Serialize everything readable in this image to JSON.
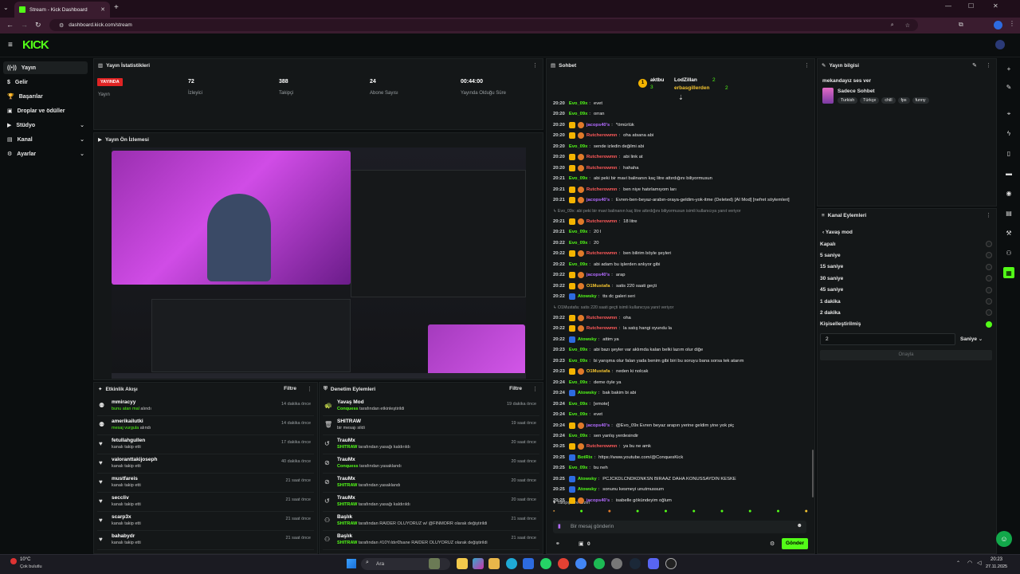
{
  "browser": {
    "tab_title": "Stream - Kick Dashboard",
    "url": "dashboard.kick.com/stream"
  },
  "header": {
    "logo": "KICK"
  },
  "sidebar": {
    "items": [
      {
        "label": "Yayın",
        "icon": "live-icon"
      },
      {
        "label": "Gelir",
        "icon": "money-icon"
      },
      {
        "label": "Başarılar",
        "icon": "trophy-icon"
      },
      {
        "label": "Droplar ve ödüller",
        "icon": "gift-icon"
      },
      {
        "label": "Stüdyo",
        "icon": "camera-icon"
      },
      {
        "label": "Kanal",
        "icon": "channel-icon"
      },
      {
        "label": "Ayarlar",
        "icon": "settings-icon"
      }
    ]
  },
  "stats": {
    "title": "Yayın İstatistikleri",
    "status": "YAYINDA",
    "status_label": "Yayın",
    "items": [
      {
        "value": "72",
        "label": "İzleyici"
      },
      {
        "value": "388",
        "label": "Takipçi"
      },
      {
        "value": "24",
        "label": "Abone Sayısı"
      },
      {
        "value": "00:44:00",
        "label": "Yayında Olduğu Süre"
      }
    ]
  },
  "preview": {
    "title": "Yayın Ön İzlemesi"
  },
  "activity": {
    "title": "Etkinlik Akışı",
    "filter": "Filtre",
    "rows": [
      {
        "name": "mmiracyy",
        "sub": "bunu atan mal",
        "sub2": "alındı",
        "time": "14 dakika önce"
      },
      {
        "name": "amerikailutki",
        "sub": "mesaj vurgula",
        "sub2": "alındı",
        "time": "14 dakika önce"
      },
      {
        "name": "fetullahgullen",
        "sub": "kanalı takip etti",
        "sub2": "",
        "time": "17 dakika önce"
      },
      {
        "name": "valoranttakijoseph",
        "sub": "kanalı takip etti",
        "sub2": "",
        "time": "40 dakika önce"
      },
      {
        "name": "mustfareis",
        "sub": "kanalı takip etti",
        "sub2": "",
        "time": "21 saat önce"
      },
      {
        "name": "seccliv",
        "sub": "kanalı takip etti",
        "sub2": "",
        "time": "21 saat önce"
      },
      {
        "name": "scarp3x",
        "sub": "kanalı takip etti",
        "sub2": "",
        "time": "21 saat önce"
      },
      {
        "name": "bahabydr",
        "sub": "kanalı takip etti",
        "sub2": "",
        "time": "21 saat önce"
      }
    ]
  },
  "moderation": {
    "title": "Denetim Eylemleri",
    "filter": "Filtre",
    "rows": [
      {
        "name": "Yavaş Mod",
        "actor": "Conquess",
        "sub": "tarafından etkinleştirildi",
        "time": "19 dakika önce"
      },
      {
        "name": "SHITRAW",
        "actor": "",
        "sub": "bir mesajı sildi",
        "time": "19 saat önce"
      },
      {
        "name": "TrauMx",
        "actor": "SHITRAW",
        "sub": "tarafından yasağı kaldırıldı",
        "time": "20 saat önce"
      },
      {
        "name": "TrauMx",
        "actor": "Conquess",
        "sub": "tarafından yasaklandı",
        "time": "20 saat önce"
      },
      {
        "name": "TrauMx",
        "actor": "SHITRAW",
        "sub": "tarafından yasaklandı",
        "time": "20 saat önce"
      },
      {
        "name": "TrauMx",
        "actor": "SHITRAW",
        "sub": "tarafından yasağı kaldırıldı",
        "time": "20 saat önce"
      },
      {
        "name": "Başlık",
        "actor": "SHITRAW",
        "sub": "tarafından RAIDER OLUYORUZ w/ @FINMORR olarak değiştirildi",
        "time": "21 saat önce"
      },
      {
        "name": "Başlık",
        "actor": "SHITRAW",
        "sub": "tarafından #10Yıldır€fsane RAIDER OLUYORUZ olarak değiştirildi",
        "time": "21 saat önce"
      }
    ]
  },
  "chat": {
    "title": "Sohbet",
    "leaders": [
      {
        "rank": "1",
        "name": "aktbu",
        "count": ""
      },
      {
        "rank": "",
        "name": "LodZillan",
        "count": "2"
      },
      {
        "rank": "",
        "name": "3",
        "count": ""
      },
      {
        "rank": "",
        "name": "erbasgillerden",
        "count": "2"
      }
    ],
    "messages": [
      {
        "t": "20:20",
        "user": "Evo_09x",
        "color": "#53fc18",
        "msg": "evet"
      },
      {
        "t": "20:20",
        "user": "Evo_09x",
        "color": "#53fc18",
        "msg": "orran"
      },
      {
        "t": "20:20",
        "user": "jacops40's",
        "color": "#b36bff",
        "msg": "*ömürlük"
      },
      {
        "t": "20:20",
        "user": "Rutcherowmn",
        "color": "#ff5a5a",
        "msg": "oha atsana abi"
      },
      {
        "t": "20:20",
        "user": "Evo_09x",
        "color": "#53fc18",
        "msg": "sende izledin değilmi abi"
      },
      {
        "t": "20:20",
        "user": "Rutcherowmn",
        "color": "#ff5a5a",
        "msg": "abi link at"
      },
      {
        "t": "20:20",
        "user": "Rutcherowmn",
        "color": "#ff5a5a",
        "msg": "hahaha"
      },
      {
        "t": "20:21",
        "user": "Evo_09x",
        "color": "#53fc18",
        "msg": "abi peki bir mavi balinanın kaç litre attırdığını biliyormusun"
      },
      {
        "t": "20:21",
        "user": "Rutcherowmn",
        "color": "#ff5a5a",
        "msg": "ben niye hatırlamıyom ları"
      },
      {
        "t": "20:21",
        "user": "jacops40's",
        "color": "#b36bff",
        "msg": "Evren-ben-beyaz-arabın-oraya-geldim-yok-itme (Deleted) [AI Mod] [nefret söylemleri]"
      },
      {
        "t": "",
        "user": "",
        "color": "#9aa0a3",
        "msg": "↳ Evo_09x: abi peki bir mavi balinanın kaç litre attırdığını biliyormusun isimli kullanıcıya yanıt veriyor"
      },
      {
        "t": "20:21",
        "user": "Rutcherowmn",
        "color": "#ff5a5a",
        "msg": "18 litre"
      },
      {
        "t": "20:21",
        "user": "Evo_09x",
        "color": "#53fc18",
        "msg": "20 l"
      },
      {
        "t": "20:22",
        "user": "Evo_09x",
        "color": "#53fc18",
        "msg": "20"
      },
      {
        "t": "20:22",
        "user": "Rutcherowmn",
        "color": "#ff5a5a",
        "msg": "ben bilirim böyle şeyleri"
      },
      {
        "t": "20:22",
        "user": "Evo_09x",
        "color": "#53fc18",
        "msg": "abi adam bu işlerden anlıyor gibi"
      },
      {
        "t": "20:22",
        "user": "jacops40's",
        "color": "#b36bff",
        "msg": "arap"
      },
      {
        "t": "20:22",
        "user": "O1Mustafa",
        "color": "#f4c430",
        "msg": "satis 220 saati geçti"
      },
      {
        "t": "20:22",
        "user": "Atowsky",
        "color": "#53fc18",
        "msg": "tts dc galeri seri"
      },
      {
        "t": "",
        "user": "",
        "color": "#9aa0a3",
        "msg": "↳ O1Mustafa: satis 220 saati geçti isimli kullanıcıya yanıt veriyor"
      },
      {
        "t": "20:22",
        "user": "Rutcherowmn",
        "color": "#ff5a5a",
        "msg": "oha"
      },
      {
        "t": "20:22",
        "user": "Rutcherowmn",
        "color": "#ff5a5a",
        "msg": "la satış hangi oyundu la"
      },
      {
        "t": "20:22",
        "user": "Atowsky",
        "color": "#53fc18",
        "msg": "attim ya"
      },
      {
        "t": "20:23",
        "user": "Evo_09x",
        "color": "#53fc18",
        "msg": "abi bazı şeyler var aklımda kalan belki lazım olur diğe"
      },
      {
        "t": "20:23",
        "user": "Evo_09x",
        "color": "#53fc18",
        "msg": "bi yarışma olur falan yada benim gibi biri bu soruyu bana sorsa tek atarım"
      },
      {
        "t": "20:23",
        "user": "O1Mustafa",
        "color": "#f4c430",
        "msg": "neden ki nolcak"
      },
      {
        "t": "20:24",
        "user": "Evo_09x",
        "color": "#53fc18",
        "msg": "deme öyle ya"
      },
      {
        "t": "20:24",
        "user": "Atowsky",
        "color": "#53fc18",
        "msg": "bak bakim bi abi"
      },
      {
        "t": "20:24",
        "user": "Evo_09x",
        "color": "#53fc18",
        "msg": "[emote]"
      },
      {
        "t": "20:24",
        "user": "Evo_09x",
        "color": "#53fc18",
        "msg": "evet"
      },
      {
        "t": "20:24",
        "user": "jacops40's",
        "color": "#b36bff",
        "msg": "@Evo_09x Evren beyaz arapın yerine geldim yine yok piç"
      },
      {
        "t": "20:24",
        "user": "Evo_09x",
        "color": "#53fc18",
        "msg": "sen yanlış yerdesindir"
      },
      {
        "t": "20:25",
        "user": "Rutcherowmn",
        "color": "#ff5a5a",
        "msg": "ya bu ne amk"
      },
      {
        "t": "20:25",
        "user": "BotRix",
        "color": "#53fc18",
        "msg": "https://www.youtube.com/@ConquesKick"
      },
      {
        "t": "20:25",
        "user": "Evo_09x",
        "color": "#53fc18",
        "msg": "bu neh"
      },
      {
        "t": "20:25",
        "user": "Atowsky",
        "color": "#53fc18",
        "msg": "PCJCKDLCNDKDNKSN BIRAAZ DAHA KONUSSAYDIN KESKE"
      },
      {
        "t": "20:25",
        "user": "Atowsky",
        "color": "#53fc18",
        "msg": "sonunu kesmeyi unutmussum"
      },
      {
        "t": "20:25",
        "user": "jacops40's",
        "color": "#b36bff",
        "msg": "isabelle gökündeyim oğlum"
      }
    ],
    "followers_only": "Takipçilere Özel",
    "input_placeholder": "Bir mesaj gönderin",
    "points": "0",
    "send_label": "Gönder"
  },
  "stream_info": {
    "title": "Yayın bilgisi",
    "stream_title": "mekandayız ses ver",
    "category": "Sadece Sohbet",
    "tags": [
      "Turkish",
      "Türkçe",
      "chill",
      "fps",
      "funny"
    ]
  },
  "channel_actions": {
    "title": "Kanal Eylemleri",
    "slow_mode_title": "Yavaş mod",
    "options": [
      "Kapalı",
      "5 saniye",
      "15 saniye",
      "30 saniye",
      "45 saniye",
      "1 dakika",
      "2 dakika",
      "Kişiselleştirilmiş"
    ],
    "selected_index": 7,
    "custom_value": "2",
    "unit": "Saniye",
    "confirm_label": "Onayla"
  },
  "taskbar": {
    "weather_temp": "10°C",
    "weather_desc": "Çok bulutlu",
    "search_placeholder": "Ara",
    "time": "20:23",
    "date": "27.11.2025"
  },
  "colors": {
    "accent": "#53fc18",
    "live_red": "#e02424"
  }
}
